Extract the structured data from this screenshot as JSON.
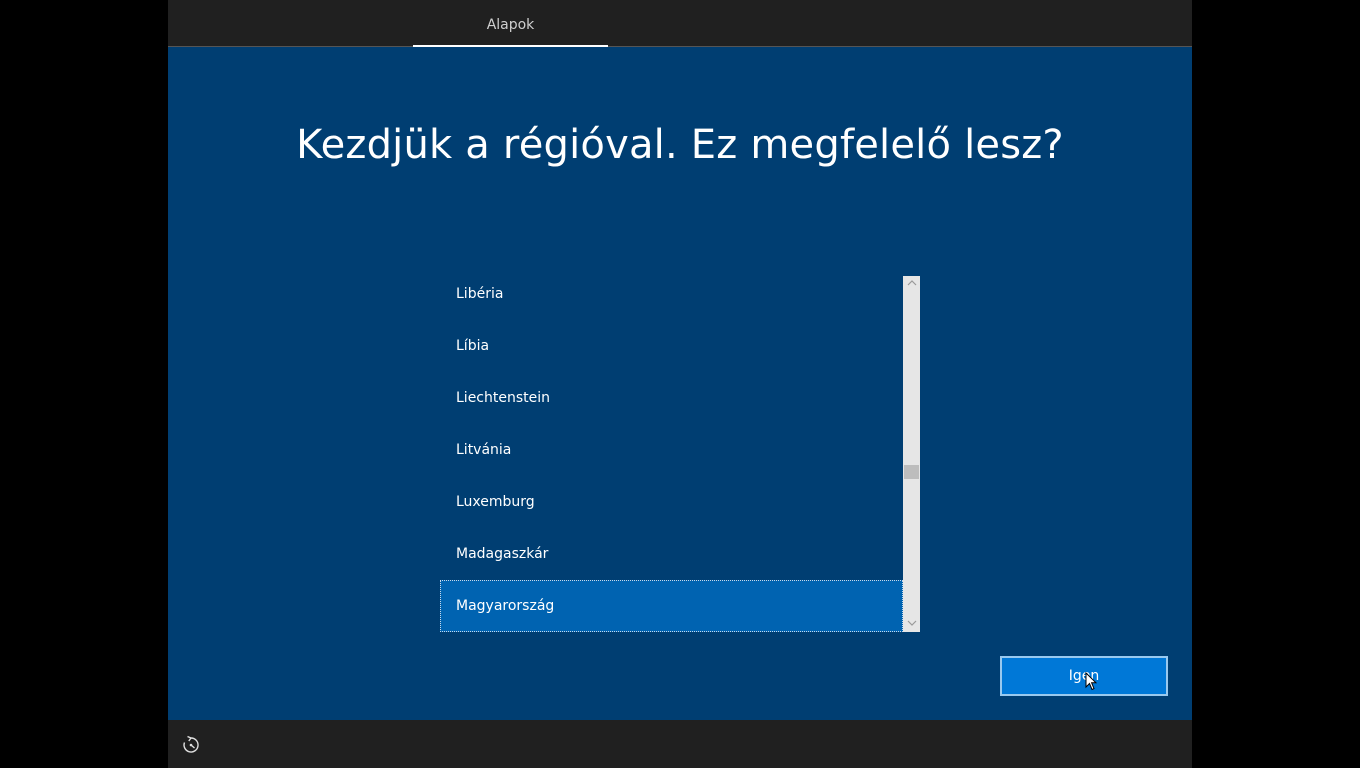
{
  "topbar": {
    "tab_label": "Alapok"
  },
  "main": {
    "headline": "Kezdjük a régióval. Ez megfelelő lesz?"
  },
  "region_list": {
    "items": [
      {
        "label": "Libéria",
        "selected": false
      },
      {
        "label": "Líbia",
        "selected": false
      },
      {
        "label": "Liechtenstein",
        "selected": false
      },
      {
        "label": "Litvánia",
        "selected": false
      },
      {
        "label": "Luxemburg",
        "selected": false
      },
      {
        "label": "Madagaszkár",
        "selected": false
      },
      {
        "label": "Magyarország",
        "selected": true
      }
    ],
    "scroll_up_icon": "chevron-up-icon",
    "scroll_down_icon": "chevron-down-icon"
  },
  "actions": {
    "yes_label": "Igen"
  },
  "bottombar": {
    "accessibility_icon": "ease-of-access-icon"
  },
  "colors": {
    "background": "#003e72",
    "bars": "#202020",
    "selection": "#0063b1",
    "button": "#0078d7"
  }
}
